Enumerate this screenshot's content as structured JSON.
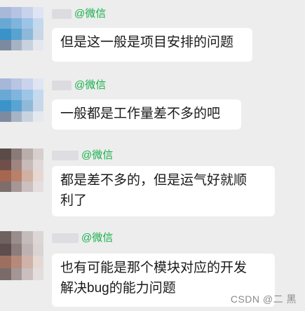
{
  "messages": [
    {
      "name_suffix": "@微信",
      "text": "但是这一般是项目安排的问题",
      "avatar_colors": [
        "#a8b8d8",
        "#b6c3e2",
        "#c9d2ec",
        "#dfe4f3",
        "#6aa8d4",
        "#7fb4dd",
        "#9cc4e6",
        "#c4d9ee",
        "#3a93c8",
        "#58a3d0",
        "#8fb8d8",
        "#c7d7e8",
        "#7c8aa0",
        "#a5b3c5",
        "#c8d2de",
        "#e4e8ee"
      ]
    },
    {
      "name_suffix": "@微信",
      "text": "一般都是工作量差不多的吧",
      "avatar_colors": [
        "#a6b7d9",
        "#b8c5e3",
        "#cad3ec",
        "#e0e5f3",
        "#6ba9d5",
        "#80b5de",
        "#9dc5e6",
        "#c5daee",
        "#3b94c9",
        "#59a4d1",
        "#90b9d9",
        "#c8d8e9",
        "#7d8ba1",
        "#a6b4c6",
        "#c9d3df",
        "#e5e9ef"
      ]
    },
    {
      "name_suffix": "@微信",
      "text": "都是差不多的，但是运气好就顺\n利了",
      "avatar_colors": [
        "#5a4a48",
        "#8a7a78",
        "#b9aeac",
        "#d6cfce",
        "#6e4f4a",
        "#9e8580",
        "#c7bab7",
        "#e0d9d8",
        "#a5674f",
        "#b9806a",
        "#d0b0a2",
        "#e6d8d1",
        "#7d6e6c",
        "#a69796",
        "#cbc0bf",
        "#e4dfde"
      ]
    },
    {
      "name_suffix": "@微信",
      "text": "也有可能是那个模块对应的开发\n解决bug的能力问题",
      "avatar_colors": [
        "#6e6160",
        "#9a8e8d",
        "#c4bcbb",
        "#dcd7d6",
        "#5d4d4c",
        "#8c7c7b",
        "#bdb2b1",
        "#d9d3d2",
        "#9c6f5f",
        "#b58a7b",
        "#cfb2a8",
        "#e5d8d3",
        "#7a6b6a",
        "#a49695",
        "#cabfbe",
        "#e3dedd"
      ]
    }
  ],
  "watermark": "CSDN @二 黑"
}
